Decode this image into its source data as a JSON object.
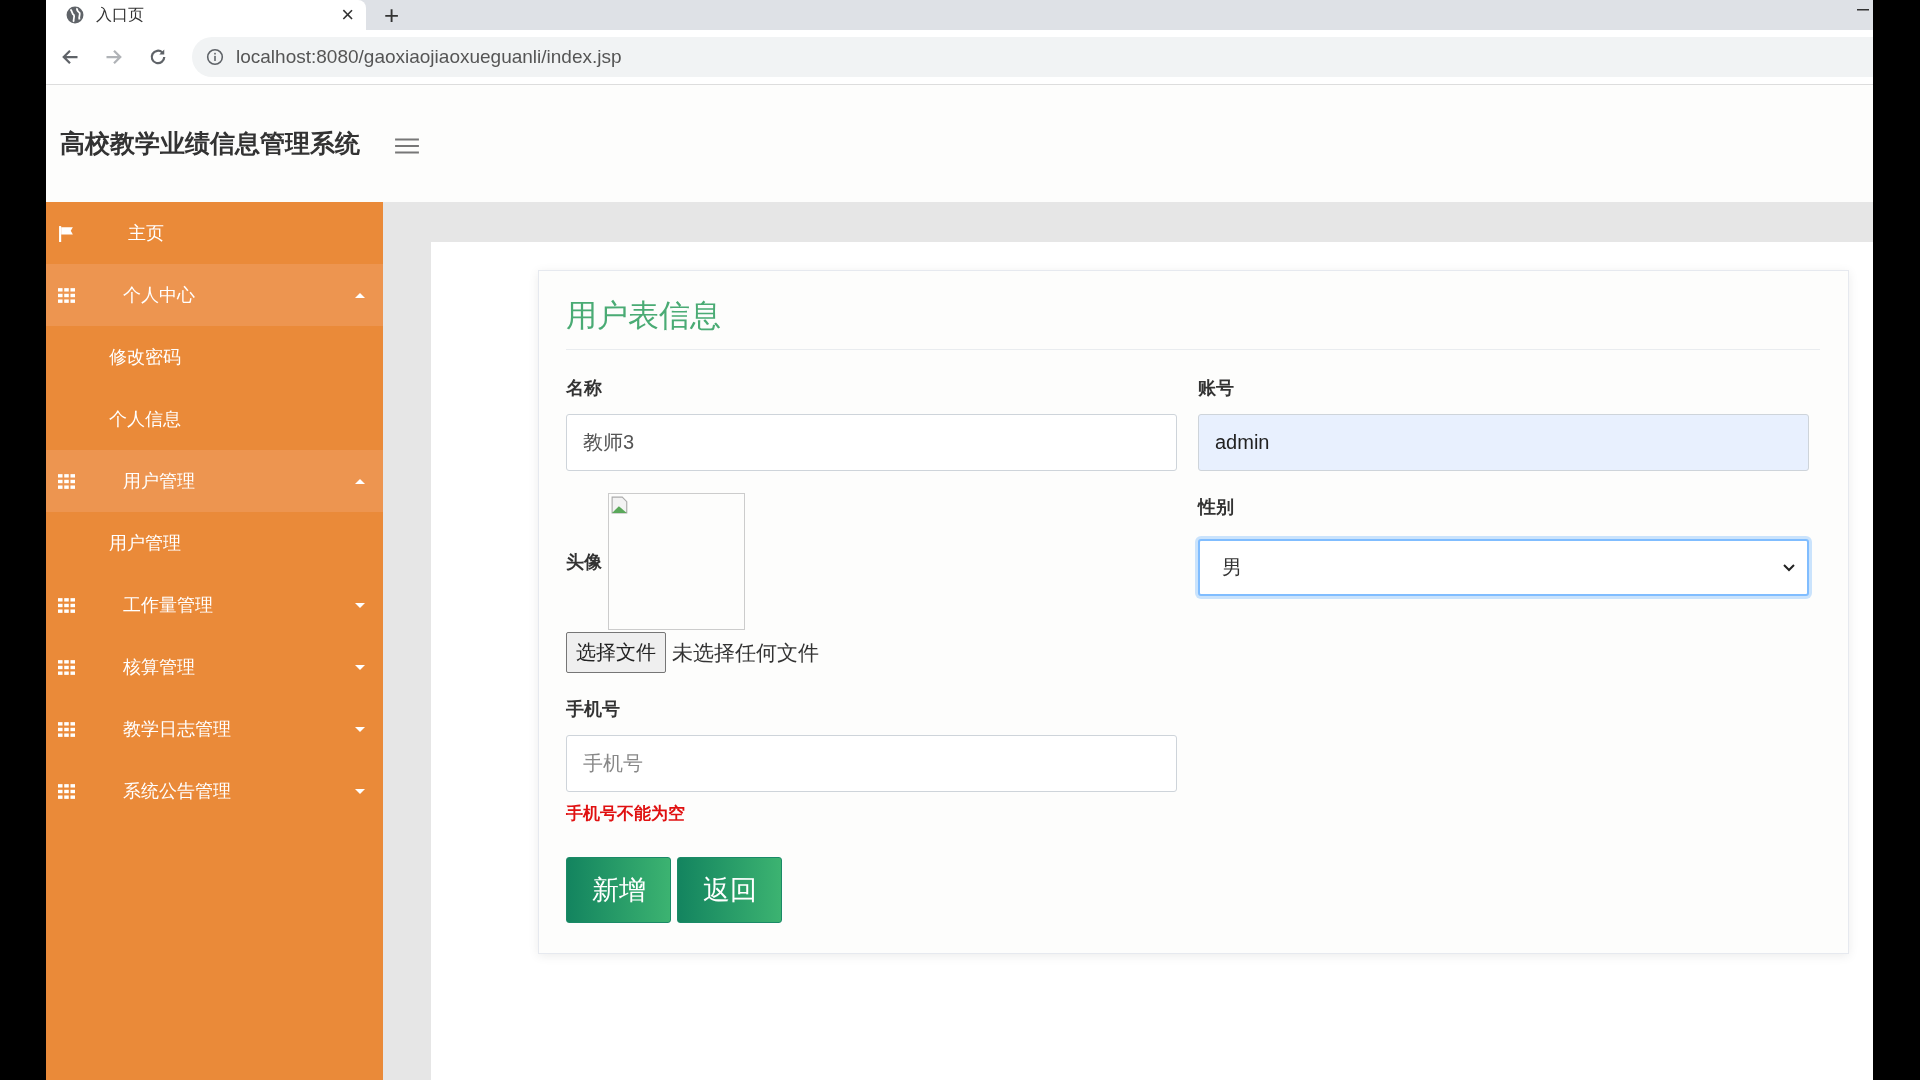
{
  "browser": {
    "tab": {
      "title": "入口页",
      "close": "×"
    },
    "new_tab": "+",
    "url": "localhost:8080/gaoxiaojiaoxueguanli/index.jsp"
  },
  "header": {
    "title": "高校教学业绩信息管理系统"
  },
  "sidebar": {
    "items": [
      {
        "label": "主页",
        "kind": "link"
      },
      {
        "label": "个人中心",
        "kind": "group",
        "expanded": true,
        "children": [
          {
            "label": "修改密码"
          },
          {
            "label": "个人信息"
          }
        ]
      },
      {
        "label": "用户管理",
        "kind": "group",
        "expanded": true,
        "children": [
          {
            "label": "用户管理"
          }
        ]
      },
      {
        "label": "工作量管理",
        "kind": "group",
        "expanded": false
      },
      {
        "label": "核算管理",
        "kind": "group",
        "expanded": false
      },
      {
        "label": "教学日志管理",
        "kind": "group",
        "expanded": false
      },
      {
        "label": "系统公告管理",
        "kind": "group",
        "expanded": false
      }
    ]
  },
  "form": {
    "title": "用户表信息",
    "name": {
      "label": "名称",
      "value": "教师3"
    },
    "account": {
      "label": "账号",
      "value": "admin"
    },
    "avatar": {
      "label": "头像",
      "file_button": "选择文件",
      "file_status": "未选择任何文件"
    },
    "gender": {
      "label": "性别",
      "value": "男"
    },
    "phone": {
      "label": "手机号",
      "placeholder": "手机号",
      "error": "手机号不能为空"
    },
    "buttons": [
      "新增",
      "返回"
    ]
  }
}
